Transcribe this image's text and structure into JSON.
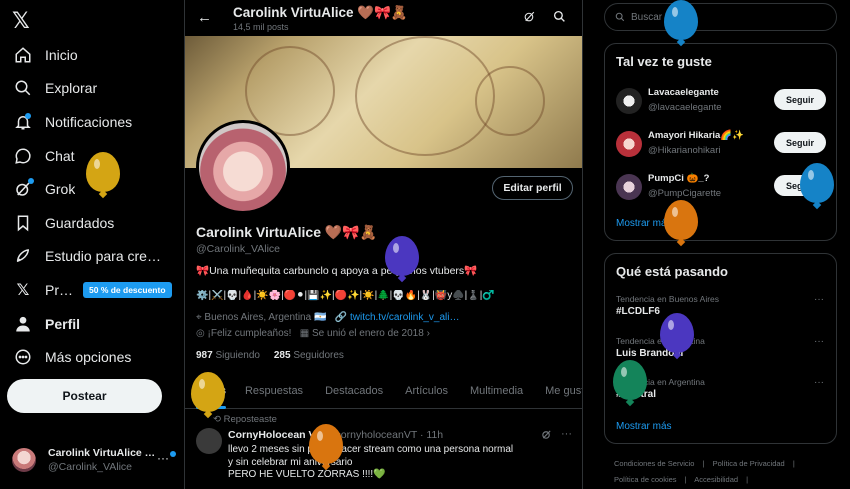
{
  "sidebar": {
    "logo": "𝕏",
    "items": [
      {
        "label": "Inicio",
        "icon": "home-icon"
      },
      {
        "label": "Explorar",
        "icon": "search-icon"
      },
      {
        "label": "Notificaciones",
        "icon": "bell-icon"
      },
      {
        "label": "Chat",
        "icon": "chat-icon"
      },
      {
        "label": "Grok",
        "icon": "grok-icon"
      },
      {
        "label": "Guardados",
        "icon": "bookmark-icon"
      },
      {
        "label": "Estudio para cre…",
        "icon": "rocket-icon"
      },
      {
        "label": "Pr…",
        "icon": "x-premium-icon",
        "badge": "50 % de descuento"
      },
      {
        "label": "Perfil",
        "icon": "person-icon"
      },
      {
        "label": "Más opciones",
        "icon": "more-circle-icon"
      }
    ],
    "post_button": "Postear",
    "account": {
      "name": "Carolink VirtuAlice …",
      "handle": "@Carolink_VAlice",
      "more": "···"
    }
  },
  "main": {
    "back": "←",
    "title": "Carolink VirtuAlice 🤎🎀🧸",
    "subtitle": "14,5 mil posts",
    "edit_profile": "Editar perfil",
    "name": "Carolink VirtuAlice 🤎🎀🧸",
    "handle": "@Carolink_VAlice",
    "bio": "🎀Una muñequita carbunclo q apoya a pequeños vtubers🎀",
    "emoji_line": "⚙️|⚔️|💀|🩸|☀️🌸|🔴⚫|💾✨|🔴✨|☀️|🌲|💀🔥|🐰|👹y♠️|♟️|♂️",
    "location": "Buenos Aires, Argentina 🇦🇷",
    "link": "twitch.tv/carolink_v_ali…",
    "birthday": "¡Feliz cumpleaños!",
    "joined": "Se unió el enero de 2018",
    "following_count": "987",
    "following_label": "Siguiendo",
    "followers_count": "285",
    "followers_label": "Seguidores",
    "tabs": [
      "Posts",
      "Respuestas",
      "Destacados",
      "Artículos",
      "Multimedia",
      "Me gusta"
    ],
    "tweet": {
      "repost_label": "Reposteaste",
      "author": "CornyHolocean VT",
      "handle_time": "@cornyholoceanVT · 11h",
      "body_lines": [
        "llevo 2 meses sin poder hacer stream como una persona normal",
        "y sin celebrar mi aniversario",
        "PERO HE VUELTO ZORRAS !!!!💚"
      ]
    }
  },
  "right": {
    "search_placeholder": "Buscar",
    "suggest_title": "Tal vez te guste",
    "suggestions": [
      {
        "name": "Lavacaelegante",
        "handle": "@lavacaelegante",
        "button": "Seguir"
      },
      {
        "name": "Amayori Hikaria🌈✨",
        "handle": "@Hikarianohikari",
        "button": "Seguir"
      },
      {
        "name": "PumpCi 🎃_?",
        "handle": "@PumpCigarette",
        "button": "Seguir"
      }
    ],
    "show_more": "Mostrar más",
    "trends_title": "Qué está pasando",
    "trends": [
      {
        "context": "Tendencia en Buenos Aires",
        "topic": "#LCDLF6"
      },
      {
        "context": "Tendencia en Argentina",
        "topic": "Luis Brandoni"
      },
      {
        "context": "Tendencia en Argentina",
        "topic": "#Central"
      }
    ],
    "trends_more": "Mostrar más",
    "footer_line1": [
      "Condiciones de Servicio",
      "|",
      "Política de Privacidad",
      "|"
    ],
    "footer_line2": [
      "Política de cookies",
      "|",
      "Accesibilidad",
      "|"
    ]
  },
  "colors": {
    "accent": "#1d9bf0",
    "background": "#000000",
    "border": "#2f3336",
    "muted": "#71767b"
  }
}
